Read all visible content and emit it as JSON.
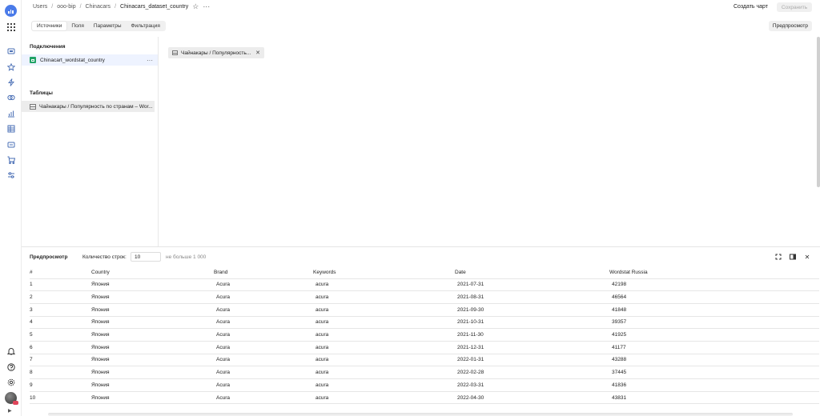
{
  "header": {
    "breadcrumbs": [
      "Users",
      "ooo-bip",
      "Chinacars",
      "Chinacars_dataset_country"
    ],
    "create_chart": "Создать чарт",
    "save": "Сохранить"
  },
  "tabs": [
    "Источники",
    "Поля",
    "Параметры",
    "Фильтрация"
  ],
  "active_tab": "Источники",
  "preview_button": "Предпросмотр",
  "sidebar": {
    "connections_title": "Подключения",
    "connection": "Chinacart_wordstat_country",
    "tables_title": "Таблицы",
    "table": "Чайнакары / Популярность по странам – Wor..."
  },
  "canvas": {
    "chip": "Чайнакары / Популярность..."
  },
  "preview": {
    "title": "Предпросмотр",
    "rows_label": "Количество строк:",
    "rows_value": "10",
    "rows_hint": "не больше 1 000",
    "columns": [
      "#",
      "Country",
      "Brand",
      "Keywords",
      "Date",
      "Wordstat Russia"
    ],
    "rows": [
      [
        "1",
        "Япония",
        "Acura",
        "acura",
        "2021-07-31",
        "42198"
      ],
      [
        "2",
        "Япония",
        "Acura",
        "acura",
        "2021-08-31",
        "46564"
      ],
      [
        "3",
        "Япония",
        "Acura",
        "acura",
        "2021-09-30",
        "41848"
      ],
      [
        "4",
        "Япония",
        "Acura",
        "acura",
        "2021-10-31",
        "39357"
      ],
      [
        "5",
        "Япония",
        "Acura",
        "acura",
        "2021-11-30",
        "41925"
      ],
      [
        "6",
        "Япония",
        "Acura",
        "acura",
        "2021-12-31",
        "41177"
      ],
      [
        "7",
        "Япония",
        "Acura",
        "acura",
        "2022-01-31",
        "43288"
      ],
      [
        "8",
        "Япония",
        "Acura",
        "acura",
        "2022-02-28",
        "37445"
      ],
      [
        "9",
        "Япония",
        "Acura",
        "acura",
        "2022-03-31",
        "41836"
      ],
      [
        "10",
        "Япония",
        "Acura",
        "acura",
        "2022-04-30",
        "43831"
      ]
    ]
  },
  "icons": {
    "rail_top": [
      "logo-icon",
      "apps-grid-icon",
      "collections-icon",
      "favorites-icon",
      "recent-icon",
      "connections-icon",
      "charts-icon",
      "datasets-icon",
      "dashboards-icon",
      "reports-icon",
      "settings-sliders-icon"
    ],
    "rail_bottom": [
      "notifications-icon",
      "help-icon",
      "settings-icon",
      "avatar",
      "expand-icon"
    ]
  },
  "colors": {
    "accent": "#4a7be9",
    "sheets_green": "#21a366",
    "selected_row": "#eef3ff"
  }
}
